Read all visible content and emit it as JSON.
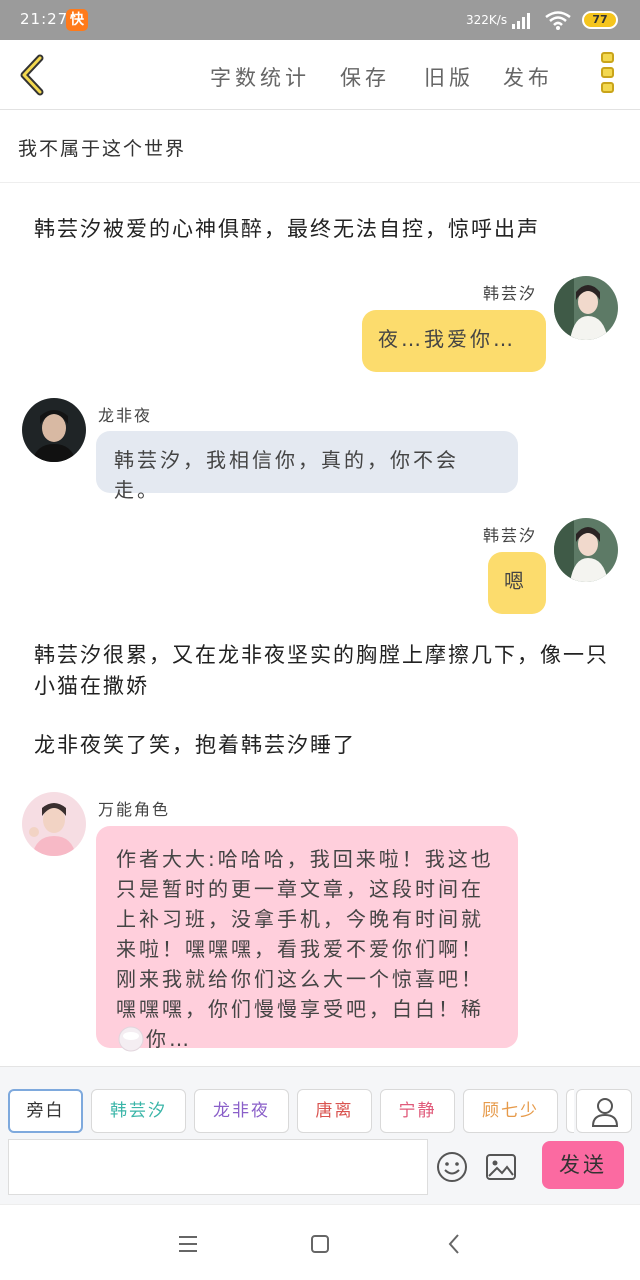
{
  "status_bar": {
    "time": "21:27",
    "app_badge": "快",
    "network_speed": "322K/s",
    "battery": "77"
  },
  "toolbar": {
    "word_count": "字数统计",
    "save": "保存",
    "old_version": "旧版",
    "publish": "发布"
  },
  "title": "我不属于这个世界",
  "messages": {
    "narration_1": "韩芸汐被爱的心神俱醉，最终无法自控，惊呼出声",
    "m1_name": "韩芸汐",
    "m1_text": "夜…我爱你…",
    "m2_name": "龙非夜",
    "m2_text": "韩芸汐，我相信你，真的，你不会走。",
    "m3_name": "韩芸汐",
    "m3_text": "嗯",
    "narration_2": "韩芸汐很累，又在龙非夜坚实的胸膛上摩擦几下，像一只小猫在撒娇",
    "narration_3": "龙非夜笑了笑，抱着韩芸汐睡了",
    "m4_name": "万能角色",
    "m4_text": "作者大大:哈哈哈，我回来啦！我这也只是暂时的更一章文章，这段时间在上补习班，没拿手机，今晚有时间就来啦！嘿嘿嘿，看我爱不爱你们啊！刚来我就给你们这么大一个惊喜吧！嘿嘿嘿，你们慢慢享受吧，白白！稀",
    "m4_text_tail": "你…"
  },
  "roles": [
    {
      "label": "旁白",
      "color": "#333333"
    },
    {
      "label": "韩芸汐",
      "color": "#3ab5a8"
    },
    {
      "label": "龙非夜",
      "color": "#8a5fc9"
    },
    {
      "label": "唐离",
      "color": "#d9534f"
    },
    {
      "label": "宁静",
      "color": "#e05a7a"
    },
    {
      "label": "顾七少",
      "color": "#e69a4a"
    }
  ],
  "send_label": "发送",
  "colors": {
    "yellow_bubble": "#fcdc6d",
    "gray_bubble": "#e4e9f1",
    "pink_bubble": "#ffcfdc",
    "send_button": "#fb6aa1"
  }
}
